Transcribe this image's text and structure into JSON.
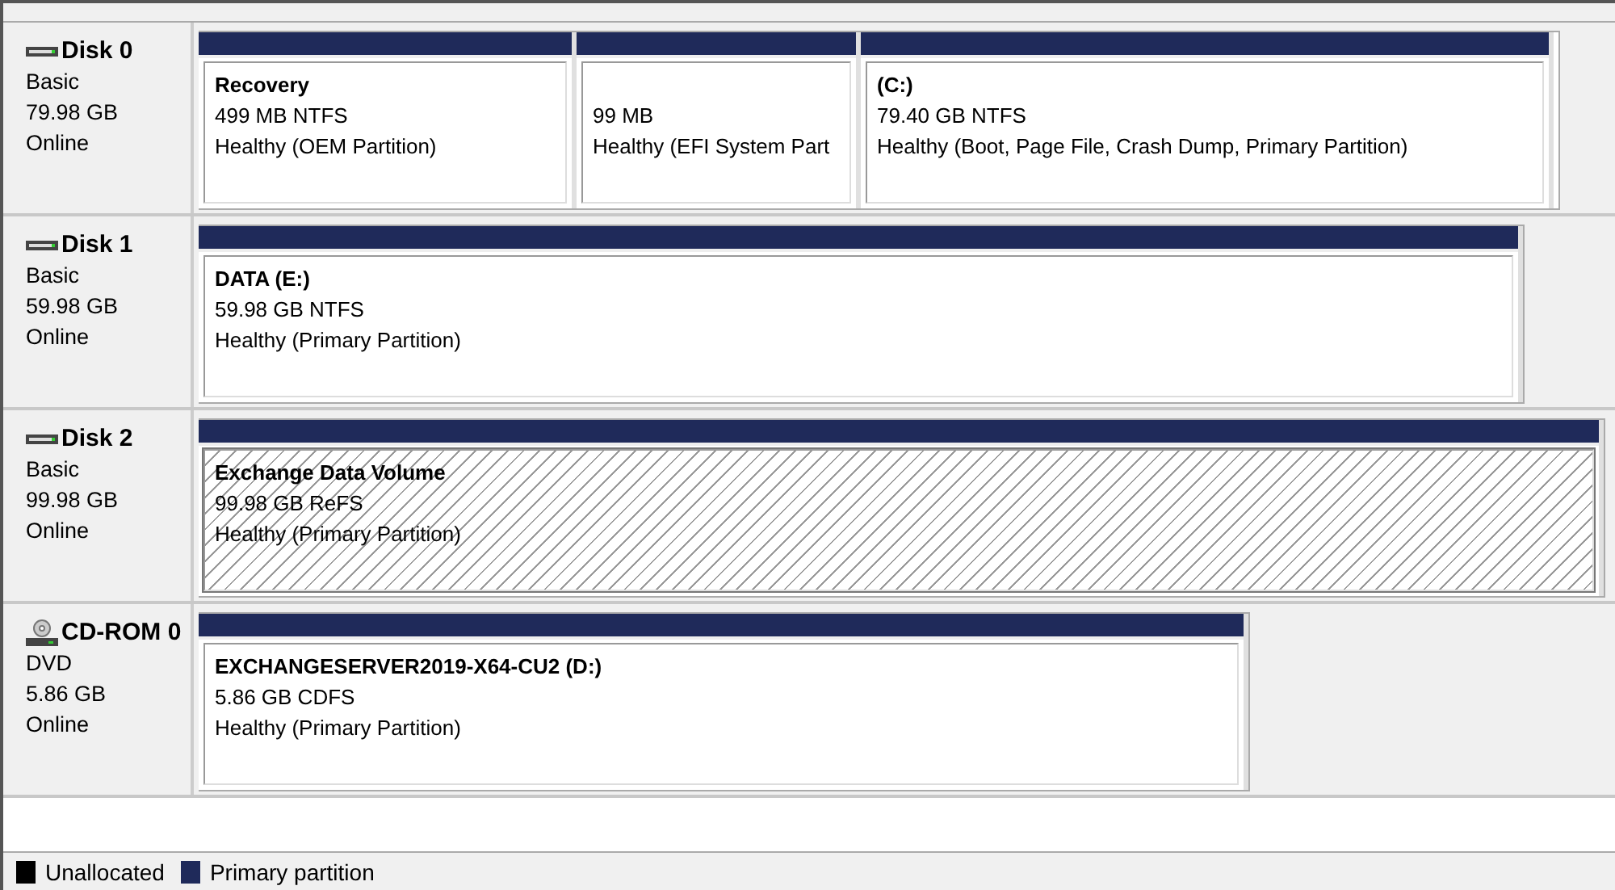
{
  "disks": [
    {
      "name": "Disk 0",
      "kind": "disk",
      "type": "Basic",
      "size": "79.98 GB",
      "status": "Online",
      "partitions": [
        {
          "label": "Recovery",
          "size": "499 MB NTFS",
          "health": "Healthy (OEM Partition)",
          "selected": false
        },
        {
          "size": "99 MB",
          "health": "Healthy (EFI System Part",
          "selected": false
        },
        {
          "label": "(C:)",
          "size": "79.40 GB NTFS",
          "health": "Healthy (Boot, Page File, Crash Dump, Primary Partition)",
          "selected": false
        }
      ]
    },
    {
      "name": "Disk 1",
      "kind": "disk",
      "type": "Basic",
      "size": "59.98 GB",
      "status": "Online",
      "partitions": [
        {
          "label": "DATA  (E:)",
          "size": "59.98 GB NTFS",
          "health": "Healthy (Primary Partition)",
          "selected": false
        }
      ]
    },
    {
      "name": "Disk 2",
      "kind": "disk",
      "type": "Basic",
      "size": "99.98 GB",
      "status": "Online",
      "partitions": [
        {
          "label": "Exchange Data Volume",
          "size": "99.98 GB ReFS",
          "health": "Healthy (Primary Partition)",
          "selected": true
        }
      ]
    },
    {
      "name": "CD-ROM 0",
      "kind": "cdrom",
      "type": "DVD",
      "size": "5.86 GB",
      "status": "Online",
      "partitions": [
        {
          "label": "EXCHANGESERVER2019-X64-CU2  (D:)",
          "size": "5.86 GB CDFS",
          "health": "Healthy (Primary Partition)",
          "selected": false
        }
      ]
    }
  ],
  "legend": [
    {
      "label": "Unallocated",
      "color": "#000000"
    },
    {
      "label": "Primary partition",
      "color": "#1f2a5a"
    }
  ]
}
